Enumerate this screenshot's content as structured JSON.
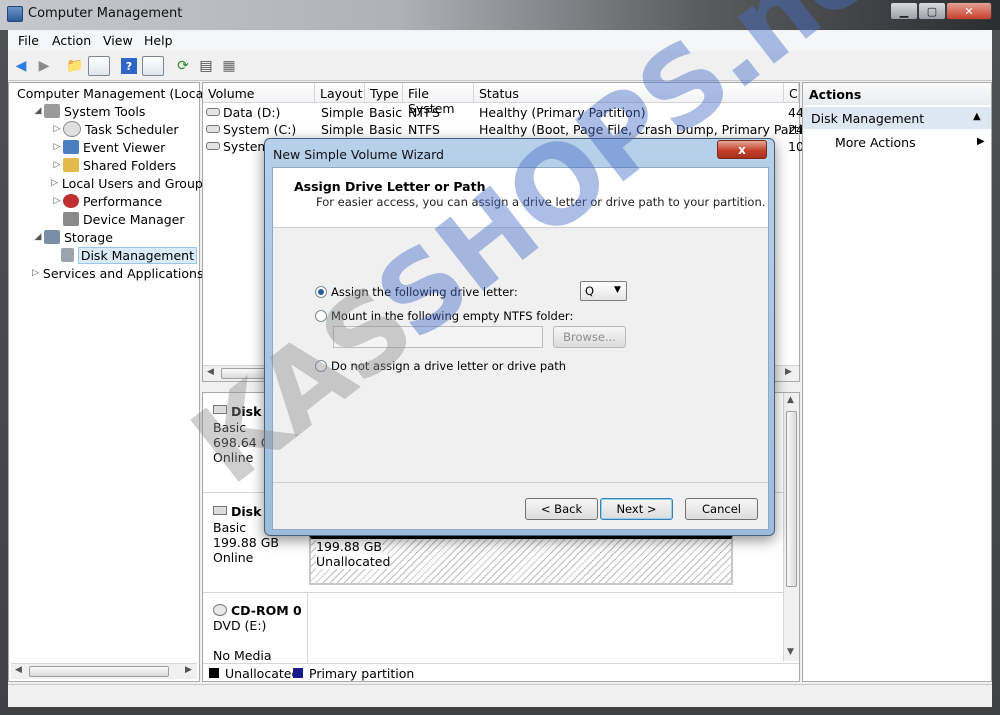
{
  "window": {
    "title": "Computer Management"
  },
  "menu": [
    "File",
    "Action",
    "View",
    "Help"
  ],
  "tree": [
    {
      "label": "Computer Management (Local",
      "level": 0,
      "icon": "computer-icon",
      "expand": ""
    },
    {
      "label": "System Tools",
      "level": 1,
      "icon": "tools-icon",
      "expand": "◢"
    },
    {
      "label": "Task Scheduler",
      "level": 2,
      "icon": "clock-icon",
      "expand": "▷"
    },
    {
      "label": "Event Viewer",
      "level": 2,
      "icon": "event-viewer-icon",
      "expand": "▷"
    },
    {
      "label": "Shared Folders",
      "level": 2,
      "icon": "shared-folder-icon",
      "expand": "▷"
    },
    {
      "label": "Local Users and Groups",
      "level": 2,
      "icon": "users-icon",
      "expand": "▷"
    },
    {
      "label": "Performance",
      "level": 2,
      "icon": "performance-icon",
      "expand": "▷"
    },
    {
      "label": "Device Manager",
      "level": 2,
      "icon": "device-manager-icon",
      "expand": ""
    },
    {
      "label": "Storage",
      "level": 1,
      "icon": "storage-icon",
      "expand": "◢"
    },
    {
      "label": "Disk Management",
      "level": 2,
      "icon": "disk-icon",
      "expand": ""
    },
    {
      "label": "Services and Applications",
      "level": 1,
      "icon": "services-icon",
      "expand": "▷"
    }
  ],
  "volumes": {
    "columns": [
      "Volume",
      "Layout",
      "Type",
      "File System",
      "Status",
      "C"
    ],
    "rows": [
      {
        "volume": "Data (D:)",
        "layout": "Simple",
        "type": "Basic",
        "fs": "NTFS",
        "status": "Healthy (Primary Partition)",
        "c": "44"
      },
      {
        "volume": "System (C:)",
        "layout": "Simple",
        "type": "Basic",
        "fs": "NTFS",
        "status": "Healthy (Boot, Page File, Crash Dump, Primary Partition)",
        "c": "24"
      },
      {
        "volume": "System",
        "layout": "",
        "type": "",
        "fs": "",
        "status": "",
        "c": "10"
      }
    ]
  },
  "disks": [
    {
      "name": "Disk 0",
      "type": "Basic",
      "size": "698.64 GB",
      "state": "Online"
    },
    {
      "name": "Disk 1",
      "type": "Basic",
      "size": "199.88 GB",
      "state": "Online",
      "part_size": "199.88 GB",
      "part_label": "Unallocated"
    },
    {
      "name": "CD-ROM 0",
      "type": "DVD (E:)",
      "size": "",
      "state": "No Media"
    }
  ],
  "legend": [
    "Unallocated",
    "Primary partition"
  ],
  "actions": {
    "header": "Actions",
    "section": "Disk Management",
    "more": "More Actions"
  },
  "dialog": {
    "title": "New Simple Volume Wizard",
    "close": "x",
    "heading": "Assign Drive Letter or Path",
    "description": "For easier access, you can assign a drive letter or drive path to your partition.",
    "option1": "Assign the following drive letter:",
    "drive_letter": "Q",
    "option2": "Mount in the following empty NTFS folder:",
    "browse": "Browse...",
    "option3": "Do not assign a drive letter or drive path",
    "back": "< Back",
    "next": "Next >",
    "cancel": "Cancel"
  },
  "watermark": {
    "part1": "KAS",
    "part2": "SHOPS.net"
  },
  "colors": {
    "accent": "#1f5f9c",
    "legend_unallocated": "#000000",
    "legend_primary": "#1a1a8c"
  }
}
